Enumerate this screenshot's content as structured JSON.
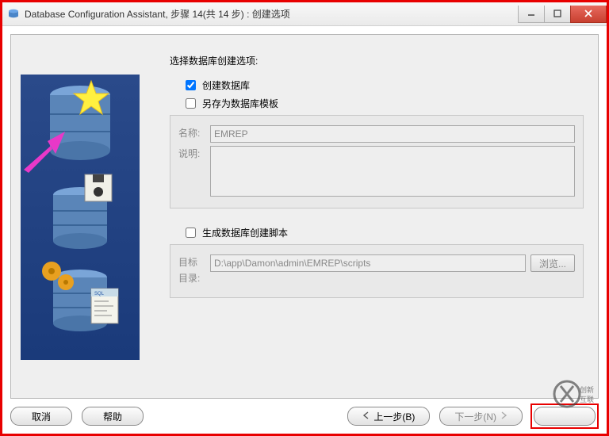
{
  "window": {
    "title": "Database Configuration Assistant, 步骤 14(共 14 步) : 创建选项"
  },
  "form": {
    "heading": "选择数据库创建选项:",
    "create_db": {
      "label": "创建数据库",
      "checked": true
    },
    "save_template": {
      "label": "另存为数据库模板",
      "checked": false,
      "name_label": "名称:",
      "name_value": "EMREP",
      "desc_label": "说明:",
      "desc_value": ""
    },
    "gen_scripts": {
      "label": "生成数据库创建脚本",
      "checked": false,
      "dest_label_line1": "目标",
      "dest_label_line2": "目录:",
      "dest_value": "D:\\app\\Damon\\admin\\EMREP\\scripts",
      "browse_label": "浏览..."
    }
  },
  "footer": {
    "cancel": "取消",
    "help": "帮助",
    "back": "上一步(B)",
    "next": "下一步(N)",
    "finish": ""
  },
  "watermark_text": "创新互联"
}
